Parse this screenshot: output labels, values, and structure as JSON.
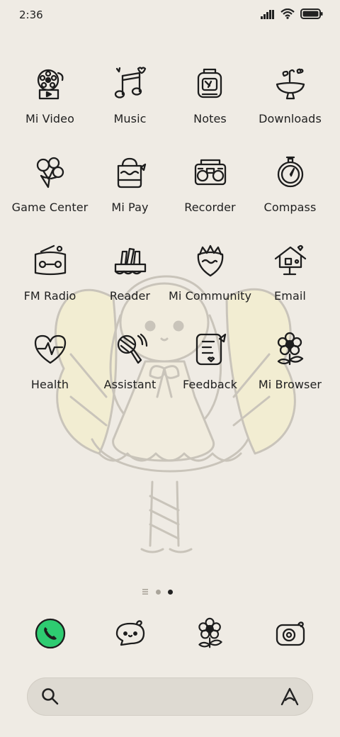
{
  "status_bar": {
    "time": "2:36",
    "icons": [
      "signal-icon",
      "wifi-icon",
      "battery-icon"
    ]
  },
  "apps": [
    {
      "label": "Mi Video",
      "icon": "film-reel-icon"
    },
    {
      "label": "Music",
      "icon": "music-note-icon"
    },
    {
      "label": "Notes",
      "icon": "notepad-icon"
    },
    {
      "label": "Downloads",
      "icon": "download-bowl-icon"
    },
    {
      "label": "Game Center",
      "icon": "balloons-icon"
    },
    {
      "label": "Mi Pay",
      "icon": "wallet-bag-icon"
    },
    {
      "label": "Recorder",
      "icon": "radio-recorder-icon"
    },
    {
      "label": "Compass",
      "icon": "compass-icon"
    },
    {
      "label": "FM Radio",
      "icon": "fm-radio-icon"
    },
    {
      "label": "Reader",
      "icon": "books-icon"
    },
    {
      "label": "Mi Community",
      "icon": "strawberry-icon"
    },
    {
      "label": "Email",
      "icon": "mailbox-house-icon"
    },
    {
      "label": "Health",
      "icon": "heart-pulse-icon"
    },
    {
      "label": "Assistant",
      "icon": "microphone-icon"
    },
    {
      "label": "Feedback",
      "icon": "feedback-note-icon"
    },
    {
      "label": "Mi Browser",
      "icon": "flower-icon"
    }
  ],
  "dock": [
    {
      "icon": "phone-icon",
      "accent": "#2ecc71"
    },
    {
      "icon": "message-bubble-icon"
    },
    {
      "icon": "flower-icon"
    },
    {
      "icon": "camera-icon"
    }
  ],
  "page_indicator": {
    "pages": 3,
    "active": 3
  },
  "search_bar": {
    "left_icon": "search-icon",
    "right_icon": "assistant-a-icon"
  }
}
